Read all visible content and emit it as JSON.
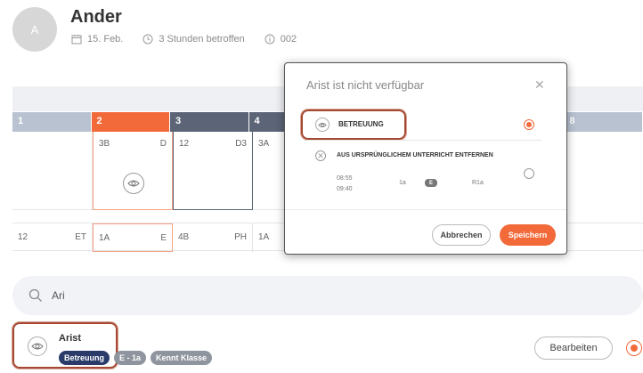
{
  "header": {
    "avatar_initial": "A",
    "title": "Ander",
    "date": "15. Feb.",
    "affected": "3 Stunden betroffen",
    "id": "002"
  },
  "schedule": {
    "periods": [
      {
        "num": "1",
        "style": "grey"
      },
      {
        "num": "2",
        "style": "orange"
      },
      {
        "num": "3",
        "style": "dark"
      },
      {
        "num": "4",
        "style": "dark"
      },
      {
        "num": "",
        "style": "grey"
      },
      {
        "num": "",
        "style": "grey"
      },
      {
        "num": "",
        "style": "grey"
      },
      {
        "num": "8",
        "style": "grey"
      }
    ],
    "lessons": [
      {
        "left": "",
        "right": ""
      },
      {
        "left": "3B",
        "right": "D"
      },
      {
        "left": "12",
        "right": "D3"
      },
      {
        "left": "3A",
        "right": ""
      }
    ],
    "row2": [
      {
        "left": "12",
        "right": "ET"
      },
      {
        "left": "1A",
        "right": "E"
      },
      {
        "left": "4B",
        "right": "PH"
      },
      {
        "left": "1A",
        "right": ""
      }
    ]
  },
  "search": {
    "value": "Ari",
    "placeholder": ""
  },
  "result": {
    "name": "Arist",
    "tags": [
      "Betreuung",
      "E - 1a",
      "Kennt Klasse"
    ],
    "edit_label": "Bearbeiten"
  },
  "dialog": {
    "title": "Arist ist nicht verfügbar",
    "option1_label": "BETREUUNG",
    "option2_label": "AUS URSPRÜNGLICHEM UNTERRICHT ENTFERNEN",
    "time_start": "08:55",
    "time_end": "09:40",
    "class": "1a",
    "badge": "E",
    "room": "R1a",
    "cancel_label": "Abbrechen",
    "save_label": "Speichern"
  },
  "colors": {
    "accent": "#f26a3a",
    "dark_blue": "#2a3b6a",
    "period_grey": "#b8c2d1",
    "period_dark": "#5b6577"
  }
}
